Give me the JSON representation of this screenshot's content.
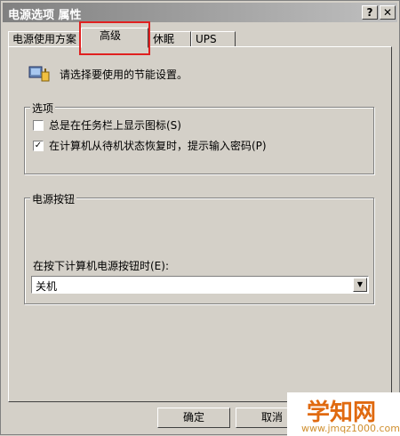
{
  "window": {
    "title": "电源选项 属性",
    "help": "?",
    "close": "✕"
  },
  "tabs": [
    "电源使用方案",
    "高级",
    "休眠",
    "UPS"
  ],
  "intro": "请选择要使用的节能设置。",
  "options": {
    "title": "选项",
    "items": [
      {
        "label": "总是在任务栏上显示图标(S)",
        "checked": false
      },
      {
        "label": "在计算机从待机状态恢复时，提示输入密码(P)",
        "checked": true
      }
    ]
  },
  "power_buttons": {
    "title": "电源按钮",
    "when_label": "在按下计算机电源按钮时(E):",
    "selected": "关机"
  },
  "buttons": {
    "ok": "确定",
    "cancel": "取消"
  },
  "watermark": {
    "text": "学知网",
    "url": "www.jmqz1000.com"
  },
  "colors": {
    "highlight": "#e02020"
  }
}
